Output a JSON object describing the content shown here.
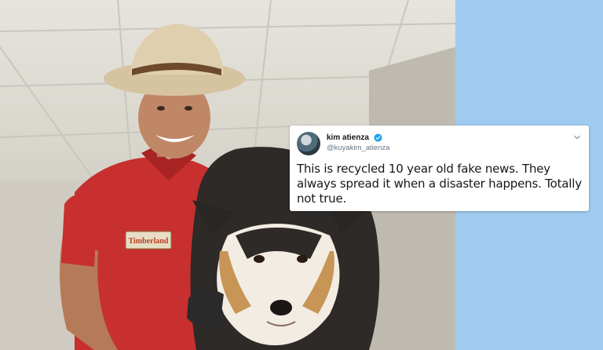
{
  "tweet": {
    "display_name": "kim atienza",
    "handle": "@kuyakim_atienza",
    "text": "This is recycled 10 year old fake news. They always spread it when a disaster happens. Totally not true.",
    "verified": true
  },
  "photo": {
    "shirt_logo": "Timberland"
  },
  "colors": {
    "background_panel": "#9ecbef",
    "card_background": "#ffffff",
    "verified_badge": "#1da1f2",
    "shirt": "#c7302f"
  },
  "icons": {
    "verified": "verified-badge-icon",
    "menu": "chevron-down-icon"
  }
}
